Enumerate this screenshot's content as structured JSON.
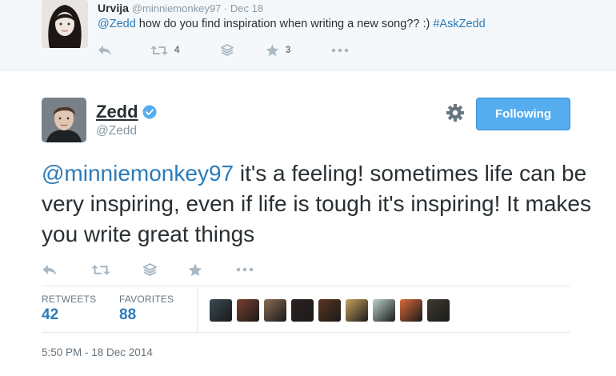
{
  "reply": {
    "name": "Urvija",
    "handle": "@minniemonkey97",
    "separator": " · ",
    "date": "Dec 18",
    "mention": "@Zedd",
    "text": " how do you find inspiration when writing a new song?? :) ",
    "hashtag": "#AskZedd",
    "retweet_count": "4",
    "favorite_count": "3"
  },
  "tweet": {
    "name": "Zedd",
    "handle": "@Zedd",
    "follow_label": "Following",
    "mention": "@minniemonkey97",
    "text": " it's a feeling! sometimes life can be very inspiring, even if life is tough it's inspiring! It makes you write great things",
    "stats": {
      "retweets_label": "RETWEETS",
      "retweets_count": "42",
      "favorites_label": "FAVORITES",
      "favorites_count": "88"
    },
    "timestamp": "5:50 PM - 18 Dec 2014"
  },
  "favoriters": [
    {
      "color": "#3a4a55"
    },
    {
      "color": "#7a3e2e"
    },
    {
      "color": "#8a6c55"
    },
    {
      "color": "#2e2020"
    },
    {
      "color": "#5a3520"
    },
    {
      "color": "#c8a060"
    },
    {
      "color": "#bcd0c8"
    },
    {
      "color": "#d86a3a"
    },
    {
      "color": "#3e3a30"
    }
  ],
  "colors": {
    "link": "#2b7bb9",
    "follow_button": "#55acee",
    "verified": "#55acee"
  },
  "icons": [
    "reply-icon",
    "retweet-icon",
    "stack-icon",
    "star-icon",
    "more-icon",
    "gear-icon",
    "verified-icon"
  ]
}
